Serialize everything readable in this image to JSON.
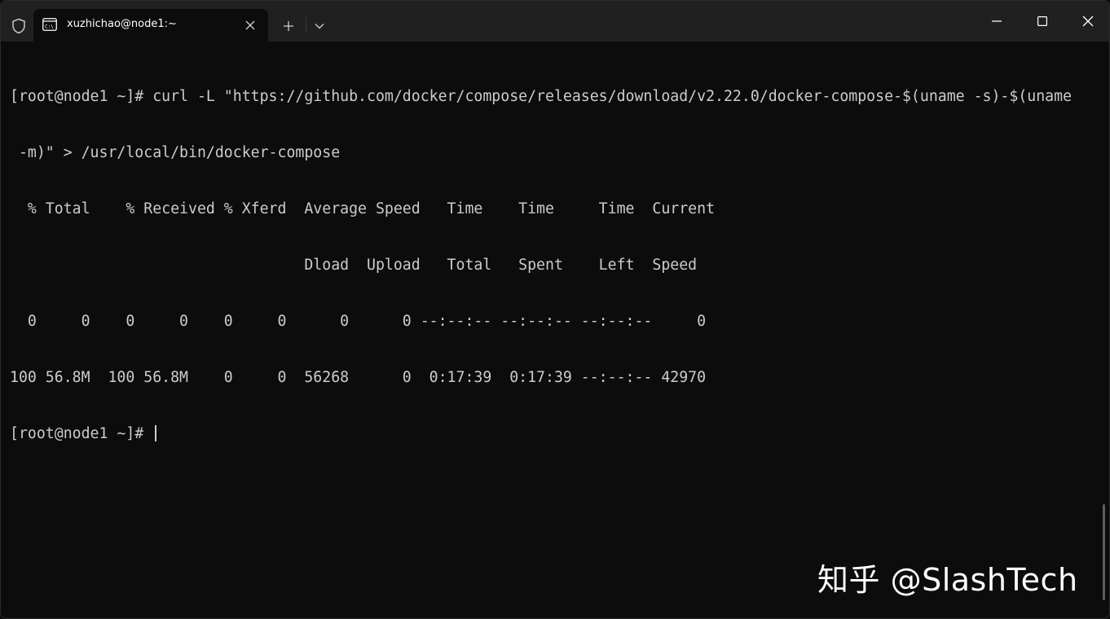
{
  "window": {
    "tab_title": "xuzhichao@node1:~",
    "tab_icon": "terminal-icon",
    "buttons": {
      "new_tab": "plus-icon",
      "dropdown": "chevron-down-icon",
      "minimize": "minimize-icon",
      "maximize": "maximize-icon",
      "close": "close-icon"
    }
  },
  "terminal": {
    "lines": [
      "[root@node1 ~]# curl -L \"https://github.com/docker/compose/releases/download/v2.22.0/docker-compose-$(uname -s)-$(uname",
      " -m)\" > /usr/local/bin/docker-compose",
      "  % Total    % Received % Xferd  Average Speed   Time    Time     Time  Current",
      "                                 Dload  Upload   Total   Spent    Left  Speed",
      "  0     0    0     0    0     0      0      0 --:--:-- --:--:-- --:--:--     0",
      "100 56.8M  100 56.8M    0     0  56268      0  0:17:39  0:17:39 --:--:-- 42970"
    ],
    "prompt": "[root@node1 ~]# "
  },
  "watermark": "知乎 @SlashTech",
  "colors": {
    "background": "#0c0c0c",
    "titlebar": "#202020",
    "text": "#cccccc"
  }
}
